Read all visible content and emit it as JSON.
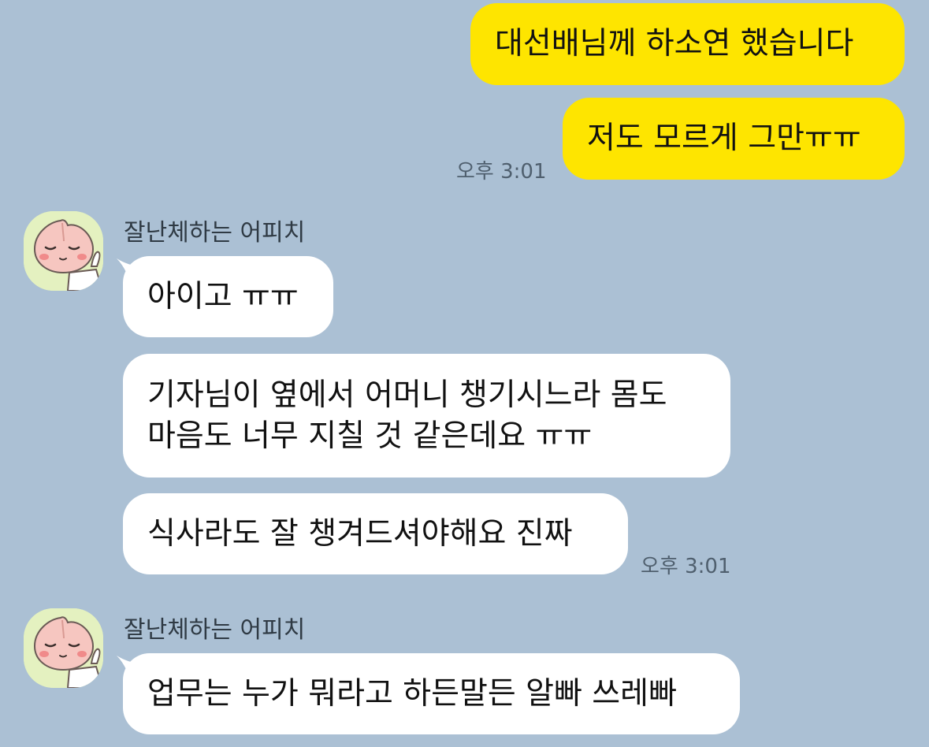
{
  "my_messages": {
    "msg1": "대선배님께 하소연 했습니다",
    "msg2": "저도 모르게 그만ㅠㅠ",
    "time": "오후 3:01"
  },
  "group1": {
    "sender": "잘난체하는 어피치",
    "msg1": "아이고 ㅠㅠ",
    "msg2_line1": "기자님이 옆에서 어머니 챙기시느라 몸도",
    "msg2_line2": "마음도 너무 지칠 것 같은데요 ㅠㅠ",
    "msg3": "식사라도 잘 챙겨드셔야해요 진짜",
    "time": "오후 3:01"
  },
  "group2": {
    "sender": "잘난체하는 어피치",
    "msg1": "업무는 누가 뭐라고 하든말든 알빠 쓰레빠"
  },
  "colors": {
    "background": "#abc0d4",
    "my_bubble": "#fee500",
    "other_bubble": "#ffffff",
    "avatar_bg": "#e4f1c0"
  },
  "icons": {
    "avatar": "apeach-avatar-icon"
  }
}
